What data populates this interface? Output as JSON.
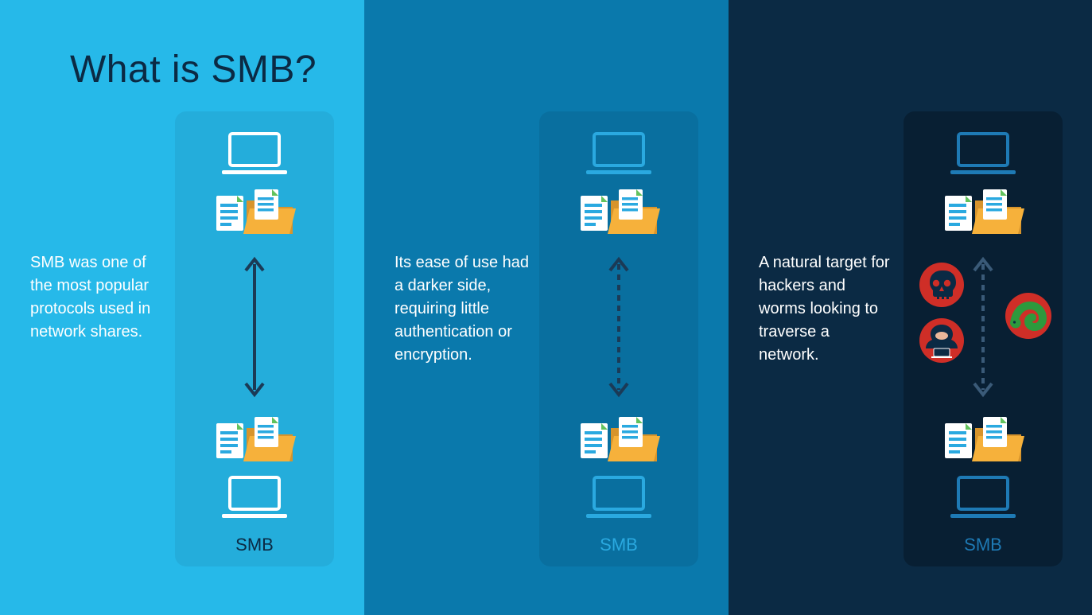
{
  "title": "What is SMB?",
  "columns": [
    {
      "bg": "#26b9e9",
      "desc": "SMB was one of the most popular protocols used in network shares.",
      "cardLabel": "SMB",
      "laptopColor": "#ffffff",
      "labelColor": "#0b2a44",
      "arrowStyle": "solid",
      "showThreats": false
    },
    {
      "bg": "#0a79ac",
      "desc": "Its ease of use had a darker side, requiring little authentication or encryption.",
      "cardLabel": "SMB",
      "laptopColor": "#2aa9e0",
      "labelColor": "#2aa9e0",
      "arrowStyle": "dashed",
      "showThreats": false
    },
    {
      "bg": "#0b2a44",
      "desc": "A natural target for hackers and worms looking to traverse a network.",
      "cardLabel": "SMB",
      "laptopColor": "#1e7ab5",
      "labelColor": "#1e7ab5",
      "arrowStyle": "dashed",
      "showThreats": true
    }
  ],
  "icons": {
    "laptop": "laptop-icon",
    "folder": "folder-icon",
    "document": "document-icon",
    "arrow": "double-arrow-icon",
    "skull": "skull-icon",
    "hacker": "hacker-icon",
    "worm": "worm-icon"
  },
  "colors": {
    "panel1": "#26b9e9",
    "panel2": "#0a79ac",
    "panel3": "#0b2a44",
    "folder": "#f6b13b",
    "folderShadow": "#d7942c",
    "docBlue": "#2aa9e0",
    "docLine": "#ffffff",
    "threatRed": "#cf2e27",
    "threatGreen": "#2d9a3d",
    "arrow": "#1b3a56"
  }
}
